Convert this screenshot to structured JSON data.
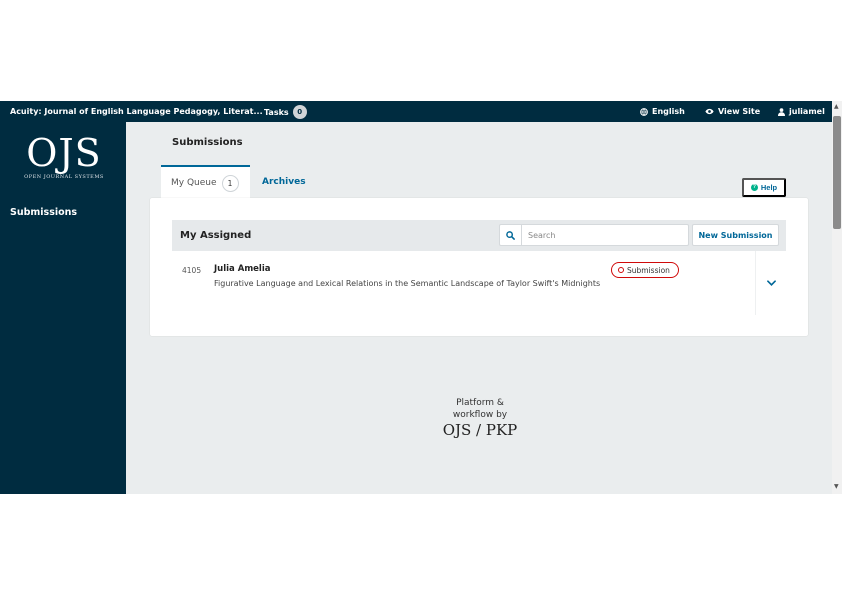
{
  "topbar": {
    "journal_name": "Acuity: Journal of English Language Pedagogy, Literat...",
    "tasks_label": "Tasks",
    "tasks_count": "0",
    "language": "English",
    "view_site": "View Site",
    "username": "juliamel"
  },
  "sidebar": {
    "logo": "OJS",
    "logo_sub": "OPEN JOURNAL SYSTEMS",
    "nav": [
      {
        "label": "Submissions"
      }
    ]
  },
  "main": {
    "page_title": "Submissions",
    "tabs": [
      {
        "label": "My Queue",
        "count": "1",
        "active": true
      },
      {
        "label": "Archives",
        "active": false
      }
    ],
    "help_label": "Help",
    "list": {
      "title": "My Assigned",
      "search_placeholder": "Search",
      "new_submission_label": "New Submission",
      "items": [
        {
          "id": "4105",
          "author": "Julia Amelia",
          "title": "Figurative Language and Lexical Relations in the Semantic Landscape of Taylor Swift's Midnights",
          "stage": "Submission"
        }
      ]
    }
  },
  "footer": {
    "line1": "Platform &",
    "line2": "workflow by",
    "logo": "OJS / PKP"
  },
  "colors": {
    "nav_dark": "#002c40",
    "primary": "#006798",
    "background": "#eaedee",
    "submission_badge": "#d00a0a",
    "help_icon": "#00b28b"
  }
}
